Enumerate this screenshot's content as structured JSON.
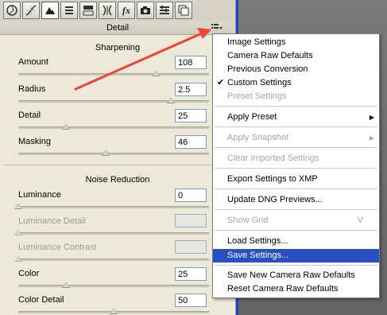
{
  "panel": {
    "header_title": "Detail",
    "sharpening": {
      "title": "Sharpening",
      "sliders": [
        {
          "label": "Amount",
          "value": "108",
          "level": 0.72,
          "disabled": false
        },
        {
          "label": "Radius",
          "value": "2.5",
          "level": 0.8,
          "disabled": false
        },
        {
          "label": "Detail",
          "value": "25",
          "level": 0.25,
          "disabled": false
        },
        {
          "label": "Masking",
          "value": "46",
          "level": 0.46,
          "disabled": false
        }
      ]
    },
    "noise_reduction": {
      "title": "Noise Reduction",
      "sliders": [
        {
          "label": "Luminance",
          "value": "0",
          "level": 0.0,
          "disabled": false
        },
        {
          "label": "Luminance Detail",
          "value": "",
          "level": 0.0,
          "disabled": true
        },
        {
          "label": "Luminance Contrast",
          "value": "",
          "level": 0.0,
          "disabled": true
        },
        {
          "label": "Color",
          "value": "25",
          "level": 0.25,
          "disabled": false
        },
        {
          "label": "Color Detail",
          "value": "50",
          "level": 0.5,
          "disabled": false
        }
      ]
    }
  },
  "toolbar": {
    "icons": [
      "aperture-icon",
      "curve-icon",
      "mountain-icon",
      "hsl-icon",
      "split-tone-icon",
      "lens-icon",
      "fx-icon",
      "camera-icon",
      "presets-icon",
      "snapshots-icon"
    ],
    "fx_label": "fx"
  },
  "menu": {
    "items": {
      "image_settings": "Image Settings",
      "camera_raw_defaults": "Camera Raw Defaults",
      "previous_conversion": "Previous Conversion",
      "custom_settings": "Custom Settings",
      "custom_settings_check": "✔",
      "preset_settings": "Preset Settings",
      "apply_preset": "Apply Preset",
      "apply_snapshot": "Apply Snapshot",
      "clear_imported": "Clear Imported Settings",
      "export_xmp": "Export Settings to XMP",
      "update_dng": "Update DNG Previews...",
      "show_grid": "Show Grid",
      "show_grid_key": "V",
      "load_settings": "Load Settings...",
      "save_settings": "Save Settings...",
      "save_new_defaults": "Save New Camera Raw Defaults",
      "reset_defaults": "Reset Camera Raw Defaults"
    },
    "submenu_arrow": "▶"
  },
  "colors": {
    "highlight": "#2a4fc2",
    "annotation_arrow": "#e8473a",
    "accent_line": "#1f3fd0"
  }
}
